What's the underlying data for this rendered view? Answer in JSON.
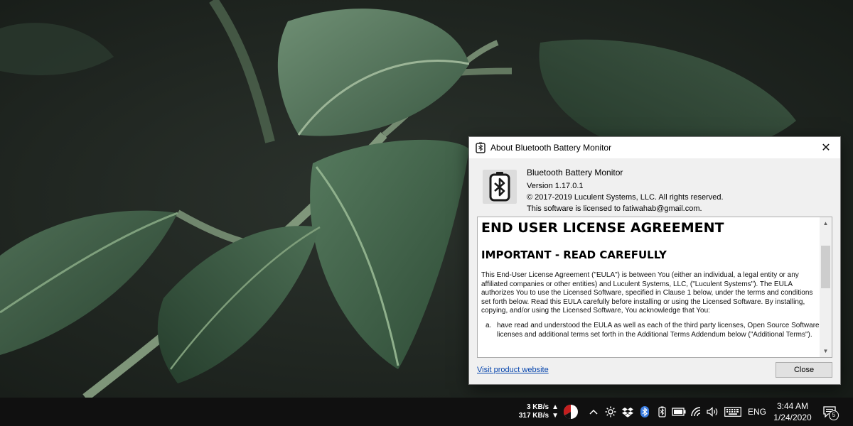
{
  "dialog": {
    "title": "About Bluetooth Battery Monitor",
    "app_name": "Bluetooth Battery Monitor",
    "version": "Version 1.17.0.1",
    "copyright": "© 2017-2019 Luculent Systems, LLC.  All rights reserved.",
    "license": "This software is licensed to fatiwahab@gmail.com.",
    "eula": {
      "heading": "END USER LICENSE AGREEMENT",
      "subheading": "IMPORTANT - READ CAREFULLY",
      "paragraph": "This End-User License Agreement (\"EULA\") is between You (either an individual, a legal entity or any affiliated companies or other entities) and Luculent Systems, LLC, (\"Luculent Systems\"). The EULA authorizes You to use the Licensed Software, specified in Clause 1 below, under the terms and conditions set forth below. Read this EULA carefully before installing or using the Licensed Software. By installing, copying, and/or using the Licensed Software, You acknowledge that You:",
      "list": [
        {
          "marker": "a.",
          "text": "have read and understood the EULA as well as each of the third party licenses, Open Source Software licenses and additional terms set forth in the Additional Terms Addendum below (\"Additional Terms\")."
        }
      ]
    },
    "visit_link": "Visit product website",
    "close_label": "Close"
  },
  "taskbar": {
    "upload_speed": "3 KB/s",
    "download_speed": "317 KB/s",
    "language": "ENG",
    "time": "3:44 AM",
    "date": "1/24/2020",
    "notification_count": "5"
  },
  "colors": {
    "taskbar_bg": "#101010",
    "dialog_bg": "#f0f0f0",
    "link": "#0645ad",
    "bluetooth_icon": "#3b7de0"
  }
}
